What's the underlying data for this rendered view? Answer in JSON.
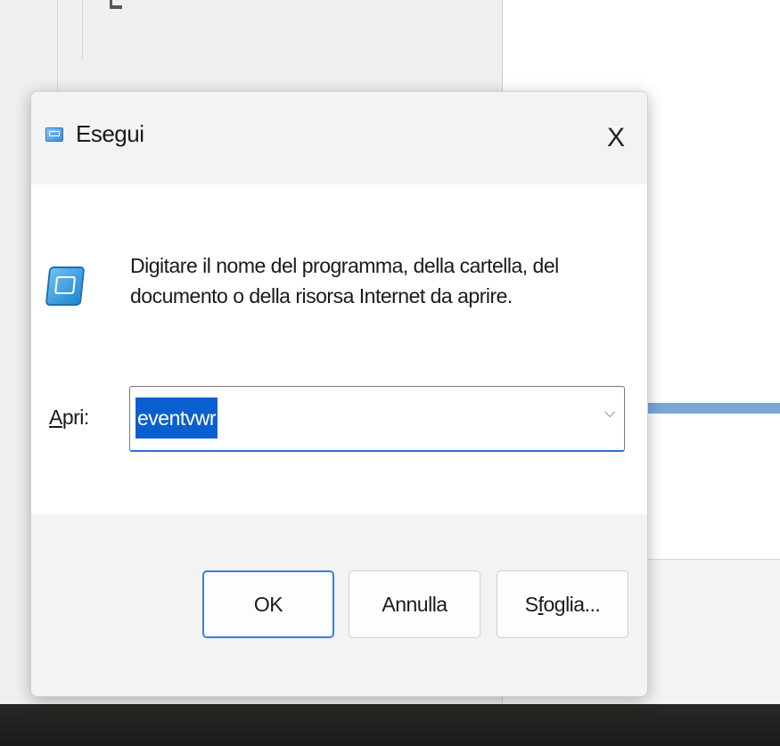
{
  "dialog": {
    "title": "Esegui",
    "close_label": "X",
    "instructions": "Digitare il nome del programma, della cartella, del documento o della risorsa Internet da aprire.",
    "open_label_underlined": "A",
    "open_label_rest": "pri:",
    "open_value": "eventvwr",
    "dropdown_arrow": "⌵",
    "ok_label": "OK",
    "cancel_label": "Annulla",
    "browse_label_pre": "S",
    "browse_label_underlined": "f",
    "browse_label_post": "oglia..."
  },
  "colors": {
    "accent": "#0a5fd0",
    "focus_border": "#3d7fd6",
    "taskbar": "#1f1e1c"
  },
  "icons": {
    "title": "run-icon",
    "body": "run-icon",
    "close": "close-icon",
    "dropdown": "chevron-down-icon"
  }
}
